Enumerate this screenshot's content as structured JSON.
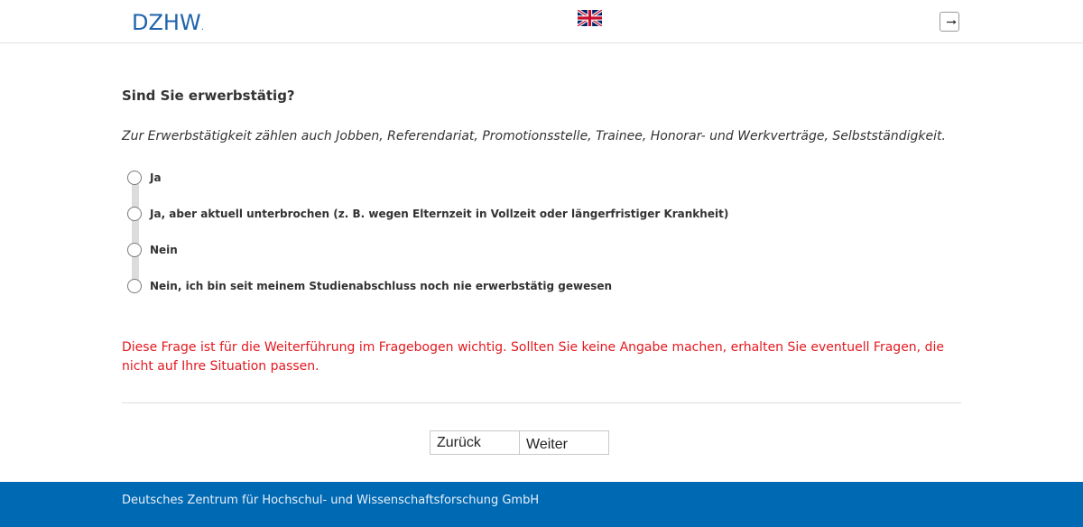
{
  "header": {
    "logo_text": "DZHW",
    "logo_dot": ".",
    "language_flag": "uk-flag-icon",
    "logout_icon": "logout-icon"
  },
  "question": {
    "title": "Sind Sie erwerbstätig?",
    "hint": "Zur Erwerbstätigkeit zählen auch Jobben, Referendariat, Promotionsstelle, Trainee, Honorar- und Werkverträge, Selbstständigkeit.",
    "options": [
      {
        "label": "Ja",
        "selected": false
      },
      {
        "label": "Ja, aber aktuell unterbrochen (z. B. wegen Elternzeit in Vollzeit oder längerfristiger Krankheit)",
        "selected": false
      },
      {
        "label": "Nein",
        "selected": false
      },
      {
        "label": "Nein, ich bin seit meinem Studienabschluss noch nie erwerbstätig gewesen",
        "selected": false
      }
    ],
    "warning": "Diese Frage ist für die Weiterführung im Fragebogen wichtig. Sollten Sie keine Angabe machen, erhalten Sie eventuell Fragen, die nicht auf Ihre Situation passen."
  },
  "navigation": {
    "back_label": "Zurück",
    "next_label": "Weiter"
  },
  "footer": {
    "text": "Deutsches Zentrum für Hochschul- und Wissenschaftsforschung GmbH"
  },
  "colors": {
    "brand_blue": "#1f63ad",
    "footer_blue": "#0069b4",
    "warning_red": "#e3181f"
  }
}
